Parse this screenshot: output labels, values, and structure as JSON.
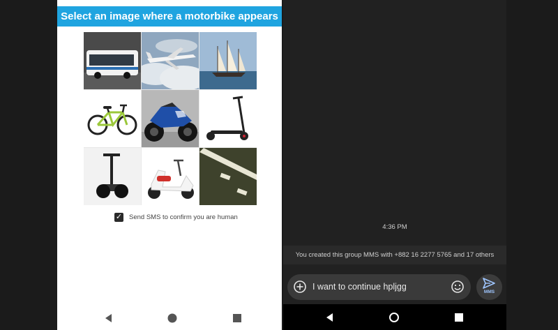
{
  "captcha": {
    "title": "Select an image where a motorbike appears",
    "tiles": [
      {
        "icon": "bus-image"
      },
      {
        "icon": "airplane-image"
      },
      {
        "icon": "sailboat-image"
      },
      {
        "icon": "bicycle-image"
      },
      {
        "icon": "sport-motorbike-image"
      },
      {
        "icon": "electric-scooter-image"
      },
      {
        "icon": "segway-image"
      },
      {
        "icon": "motor-scooter-image"
      },
      {
        "icon": "road-marking-image"
      }
    ],
    "sms_checkbox": {
      "checked": true,
      "label": "Send SMS to confirm you are human"
    }
  },
  "messages": {
    "timestamp": "4:36 PM",
    "created_notice": "You created this group MMS with +882 16 2277 5765 and 17 others",
    "compose_text": "I want to continue hpljgg",
    "send_label": "MMS"
  },
  "colors": {
    "banner": "#1fa4e0",
    "dark_bg": "#212121",
    "compose_bg": "#3a3a3a",
    "send_accent": "#9fc6ff"
  }
}
